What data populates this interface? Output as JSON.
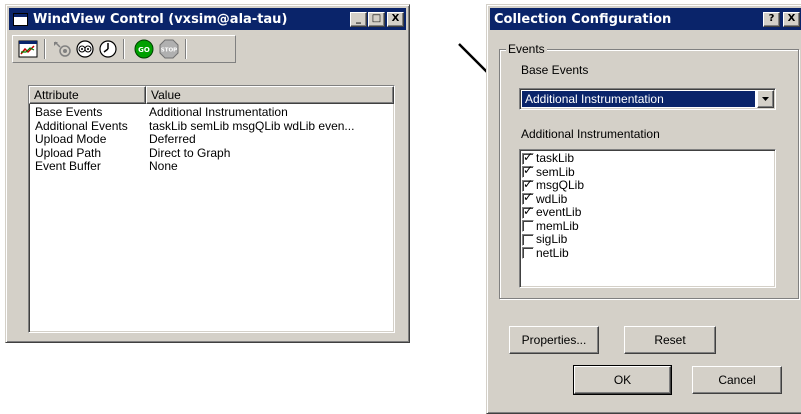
{
  "windview": {
    "title": "WindView Control (vxsim@ala-tau)",
    "title_buttons": [
      "_",
      "□",
      "X"
    ],
    "toolbar": {
      "icons": [
        "config-icon",
        "trigger-icon",
        "view-icon",
        "timer-icon",
        "go-icon",
        "stop-icon"
      ],
      "go_label": "GO",
      "stop_label": "STOP"
    },
    "grid": {
      "headers": [
        "Attribute",
        "Value"
      ],
      "rows": [
        [
          "Base Events",
          "Additional Instrumentation"
        ],
        [
          "Additional Events",
          "taskLib semLib msgQLib wdLib even..."
        ],
        [
          "Upload Mode",
          "Deferred"
        ],
        [
          "Upload Path",
          "Direct to Graph"
        ],
        [
          "Event Buffer",
          "None"
        ]
      ]
    }
  },
  "dialog": {
    "title": "Collection Configuration",
    "help_button": "?",
    "close_button": "X",
    "events_group": "Events",
    "base_events_label": "Base Events",
    "base_events_value": "Additional Instrumentation",
    "additional_label": "Additional Instrumentation",
    "libs": [
      {
        "name": "taskLib",
        "checked": true
      },
      {
        "name": "semLib",
        "checked": true
      },
      {
        "name": "msgQLib",
        "checked": true
      },
      {
        "name": "wdLib",
        "checked": true
      },
      {
        "name": "eventLib",
        "checked": true
      },
      {
        "name": "memLib",
        "checked": false
      },
      {
        "name": "sigLib",
        "checked": false
      },
      {
        "name": "netLib",
        "checked": false
      }
    ],
    "properties_button": "Properties...",
    "reset_button": "Reset",
    "ok_button": "OK",
    "cancel_button": "Cancel"
  },
  "colors": {
    "titlebar": "#0a246a",
    "face": "#d4d0c8",
    "selection": "#0a246a"
  }
}
